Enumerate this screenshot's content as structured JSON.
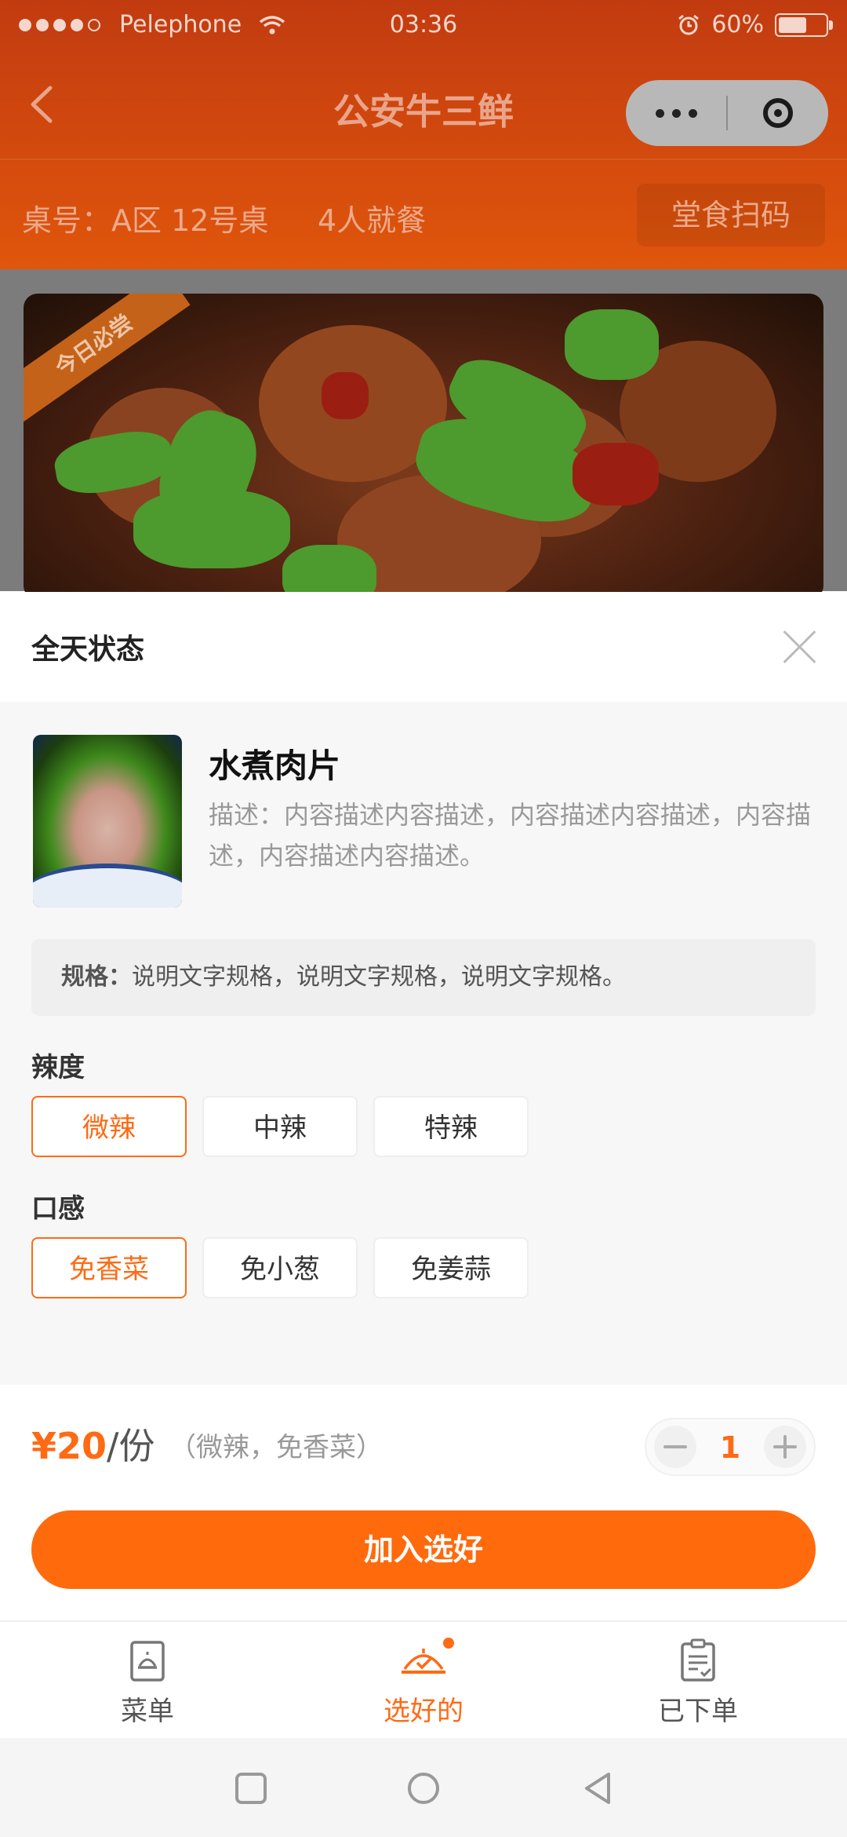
{
  "status_bar": {
    "carrier": "Pelephone",
    "time": "03:36",
    "battery": "60%",
    "battery_level": 0.6
  },
  "nav": {
    "title": "公安牛三鲜"
  },
  "table_bar": {
    "table_no": "桌号：A区 12号桌",
    "diners": "4人就餐",
    "scan_button": "堂食扫码"
  },
  "banner": {
    "ribbon": "今日必尝"
  },
  "sheet": {
    "title": "全天状态",
    "dish": {
      "name": "水煮肉片",
      "description": "描述：内容描述内容描述，内容描述内容描述，内容描述，内容描述内容描述。"
    },
    "spec": {
      "label": "规格：",
      "text": "说明文字规格，说明文字规格，说明文字规格。"
    },
    "spice": {
      "label": "辣度",
      "options": [
        "微辣",
        "中辣",
        "特辣"
      ],
      "selected": "微辣"
    },
    "texture": {
      "label": "口感",
      "options": [
        "免香菜",
        "免小葱",
        "免姜蒜"
      ],
      "selected": "免香菜"
    },
    "price": {
      "amount": "¥20",
      "unit": "/份",
      "note": "（微辣，免香菜）"
    },
    "quantity": "1",
    "add_button": "加入选好"
  },
  "tabs": [
    {
      "label": "菜单",
      "icon": "menu-icon",
      "active": false
    },
    {
      "label": "选好的",
      "icon": "cloche-icon",
      "active": true
    },
    {
      "label": "已下单",
      "icon": "clipboard-icon",
      "active": false
    }
  ],
  "colors": {
    "accent": "#ff6a14",
    "header_bg": "#d4480c",
    "sheet_body_bg": "#f7f7f7"
  }
}
